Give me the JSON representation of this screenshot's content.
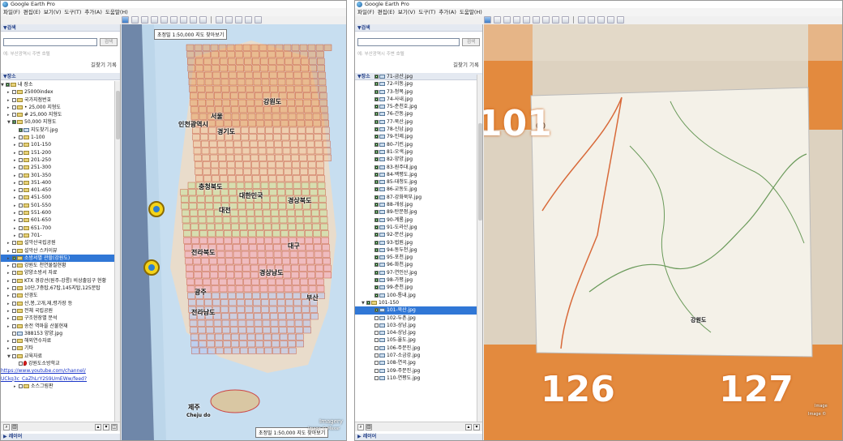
{
  "app_title": "Google Earth Pro",
  "menu": [
    "파일(F)",
    "편집(E)",
    "보기(V)",
    "도구(T)",
    "추가(A)",
    "도움말(H)"
  ],
  "search": {
    "heading": "▼검색",
    "button": "검색",
    "hint": "예: 부산광역시 주변 호텔",
    "directions": "길찾기 기록"
  },
  "places_heading": "▼장소",
  "layers_heading": "▶ 레이어",
  "left_tree": [
    {
      "t": "내 장소",
      "exp": "▼",
      "ico": "folder",
      "cb": true
    },
    {
      "t": "25000index",
      "exp": "▸",
      "ico": "folder",
      "cb": false
    },
    {
      "t": "국가지점번호",
      "exp": "▸",
      "ico": "folder",
      "cb": false
    },
    {
      "t": "• 25,000 지형도",
      "exp": "▸",
      "ico": "folder",
      "cb": false
    },
    {
      "t": "# 25,000 지형도",
      "exp": "▸",
      "ico": "folder",
      "cb": false
    },
    {
      "t": "50,000 지형도",
      "exp": "▼",
      "ico": "folder",
      "cb": true
    },
    {
      "t": "지도찾기.jpg",
      "exp": "",
      "ico": "img",
      "cb": true
    },
    {
      "t": "1-100",
      "exp": "▸",
      "ico": "folder",
      "cb": false
    },
    {
      "t": "101-150",
      "exp": "▸",
      "ico": "folder",
      "cb": false
    },
    {
      "t": "151-200",
      "exp": "▸",
      "ico": "folder",
      "cb": false
    },
    {
      "t": "201-250",
      "exp": "▸",
      "ico": "folder",
      "cb": false
    },
    {
      "t": "251-300",
      "exp": "▸",
      "ico": "folder",
      "cb": false
    },
    {
      "t": "301-350",
      "exp": "▸",
      "ico": "folder",
      "cb": false
    },
    {
      "t": "351-400",
      "exp": "▸",
      "ico": "folder",
      "cb": false
    },
    {
      "t": "401-450",
      "exp": "▸",
      "ico": "folder",
      "cb": false
    },
    {
      "t": "451-500",
      "exp": "▸",
      "ico": "folder",
      "cb": false
    },
    {
      "t": "501-550",
      "exp": "▸",
      "ico": "folder",
      "cb": false
    },
    {
      "t": "551-600",
      "exp": "▸",
      "ico": "folder",
      "cb": false
    },
    {
      "t": "601-650",
      "exp": "▸",
      "ico": "folder",
      "cb": false
    },
    {
      "t": "651-700",
      "exp": "▸",
      "ico": "folder",
      "cb": false
    },
    {
      "t": "701-",
      "exp": "▸",
      "ico": "folder",
      "cb": false
    },
    {
      "t": "설악산국립공원",
      "exp": "▸",
      "ico": "folder",
      "cb": false
    },
    {
      "t": "설악산 스카이뷰",
      "exp": "▸",
      "ico": "folder",
      "cb": false
    },
    {
      "t": "소방서별 관할(강원도)",
      "exp": "▸",
      "ico": "folder",
      "cb": true,
      "sel": true
    },
    {
      "t": "강원도 천연물질현황",
      "exp": "▸",
      "ico": "folder",
      "cb": false
    },
    {
      "t": "양양소방서 자료",
      "exp": "▸",
      "ico": "folder",
      "cb": false
    },
    {
      "t": "KTX 경강선(원주-강릉) 비상출입구 현황",
      "exp": "▸",
      "ico": "folder",
      "cb": false
    },
    {
      "t": "10단,7층탑,67탑,145지탑,125문탑",
      "exp": "▸",
      "ico": "folder",
      "cb": false
    },
    {
      "t": "산경도",
      "exp": "▸",
      "ico": "folder",
      "cb": false
    },
    {
      "t": "산,봉,고개,재,령가장 등",
      "exp": "▸",
      "ico": "folder",
      "cb": false
    },
    {
      "t": "전체 국립공원",
      "exp": "▸",
      "ico": "folder",
      "cb": false
    },
    {
      "t": "구조현장별 분석",
      "exp": "▸",
      "ico": "folder",
      "cb": false
    },
    {
      "t": "송전 역마을 산불현재",
      "exp": "▸",
      "ico": "folder",
      "cb": false
    },
    {
      "t": "388153 양양.jpg",
      "exp": "",
      "ico": "img",
      "cb": false
    },
    {
      "t": "해외연수자료",
      "exp": "▸",
      "ico": "folder",
      "cb": false
    },
    {
      "t": "기타",
      "exp": "▸",
      "ico": "folder",
      "cb": false
    },
    {
      "t": "교육자료",
      "exp": "▼",
      "ico": "folder",
      "cb": false
    },
    {
      "t": "강원도소방학교",
      "exp": "",
      "ico": "pin",
      "cb": false
    }
  ],
  "left_links": [
    "https://www.youtube.com/channel/",
    "UCkq3c_CaZhLrY2S9UmEWw/feed?"
  ],
  "left_tree_tail": "소스그림판",
  "right_tree_top": [
    "71-금산.jpg",
    "72-이동.jpg",
    "73-청목.jpg",
    "74-사내.jpg",
    "75-춘천호.jpg",
    "76-간동.jpg",
    "77-북산.jpg",
    "78-신남.jpg",
    "79-인제.jpg",
    "80-기린.jpg",
    "81-오색.jpg",
    "82-양양.jpg",
    "83-원주대.jpg",
    "84-백평도.jpg",
    "85-대청도.jpg",
    "86-교동도.jpg",
    "87-강화북부.jpg",
    "88-개성.jpg",
    "89-탄문점.jpg",
    "90-계룡.jpg",
    "91-도라산.jpg",
    "92-문산.jpg",
    "93-법원.jpg",
    "94-동두천.jpg",
    "95-포천.jpg",
    "96-화천.jpg",
    "97-연인산.jpg",
    "98-가평.jpg",
    "99-춘천.jpg",
    "100-통내.jpg"
  ],
  "right_folder": "101-150",
  "right_tree_bottom": [
    "101-북산.jpg",
    "102-두촌.jpg",
    "103-상남.jpg",
    "104-상남.jpg",
    "105-율도.jpg",
    "106-주문진.jpg",
    "107-소금강.jpg",
    "108-연곡.jpg",
    "109-주문진.jpg",
    "110-연평도.jpg"
  ],
  "map1": {
    "banner_top": "초정밀 1:50,000 지도 찾아보기",
    "banner_bottom": "초정밀 1:50,000 지도 찾아보기",
    "labels": [
      "강원도",
      "서울",
      "인천광역시",
      "경기도",
      "대한민국",
      "충청북도",
      "대전",
      "경상북도",
      "전라북도",
      "대구",
      "경상남도",
      "광주",
      "전라남도",
      "부산",
      "제주",
      "Cheju do"
    ],
    "badge": "Image © Maxar",
    "image_credit": "Imagery"
  },
  "map2": {
    "numbers": [
      "101",
      "126",
      "127"
    ],
    "region_label": "강원도",
    "credit_top": "Image",
    "credit_bottom": "Image © "
  }
}
